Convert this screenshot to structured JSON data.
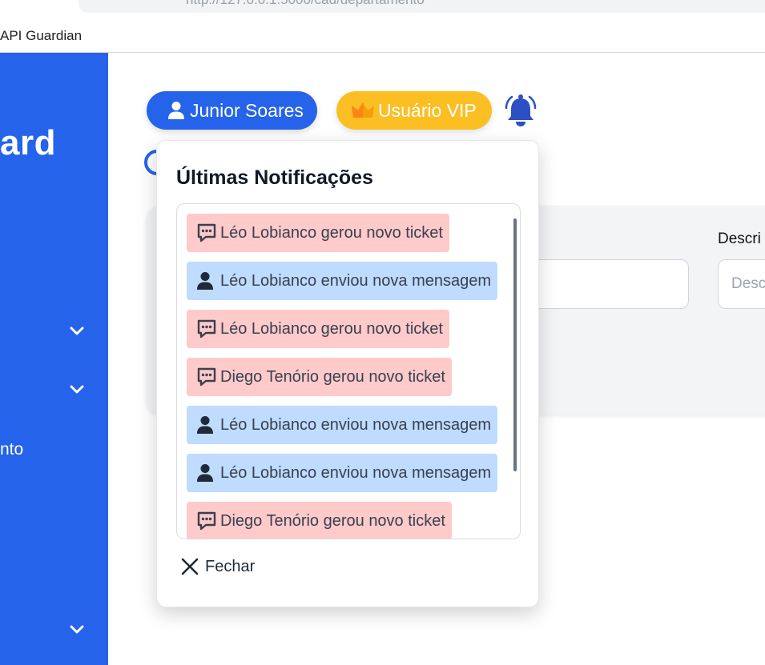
{
  "browser": {
    "url": "http://127.0.0.1:5000/cad/departamento",
    "bookmark": "API Guardian"
  },
  "sidebar": {
    "logo_fragment": "ard",
    "partial_item_label": "nto"
  },
  "header": {
    "user_name": "Junior Soares",
    "vip_label": "Usuário VIP"
  },
  "form": {
    "description_label": "Descri",
    "description_placeholder": "Desc"
  },
  "popup": {
    "title": "Últimas Notificações",
    "close_label": "Fechar",
    "notifications": [
      {
        "type": "ticket",
        "icon": "chat-dots-icon",
        "text": "Léo Lobianco gerou novo ticket"
      },
      {
        "type": "message",
        "icon": "person-icon",
        "text": "Léo Lobianco enviou nova mensagem"
      },
      {
        "type": "ticket",
        "icon": "chat-dots-icon",
        "text": "Léo Lobianco gerou novo ticket"
      },
      {
        "type": "ticket",
        "icon": "chat-dots-icon",
        "text": "Diego Tenório gerou novo ticket"
      },
      {
        "type": "message",
        "icon": "person-icon",
        "text": "Léo Lobianco enviou nova mensagem"
      },
      {
        "type": "message",
        "icon": "person-icon",
        "text": "Léo Lobianco enviou nova mensagem"
      },
      {
        "type": "ticket",
        "icon": "chat-dots-icon",
        "text": "Diego Tenório gerou novo ticket"
      }
    ]
  },
  "colors": {
    "sidebar": "#2563eb",
    "vip": "#fbbf24",
    "ticket_bg": "#fecaca",
    "message_bg": "#bfdbfe"
  }
}
